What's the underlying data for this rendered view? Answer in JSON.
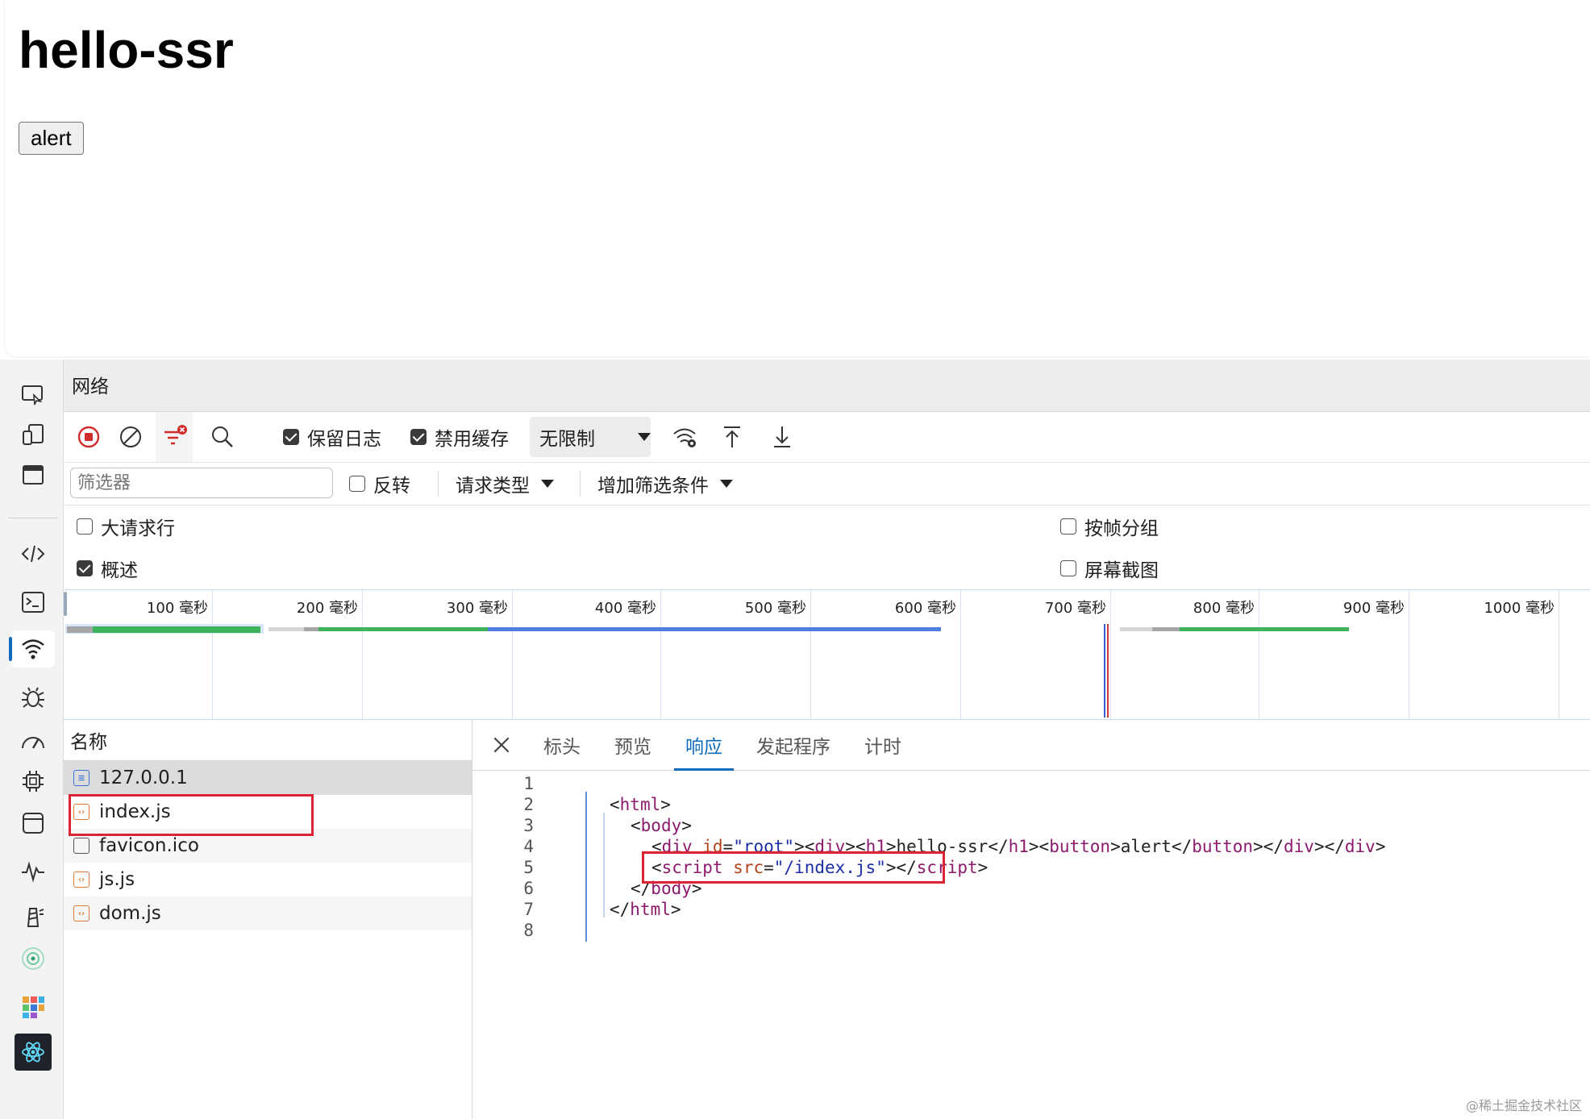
{
  "page": {
    "heading": "hello-ssr",
    "button_label": "alert"
  },
  "panel": {
    "title": "网络"
  },
  "toolbar": {
    "preserve_log": "保留日志",
    "preserve_log_checked": true,
    "disable_cache": "禁用缓存",
    "disable_cache_checked": true,
    "throttling": "无限制"
  },
  "filter": {
    "placeholder": "筛选器",
    "invert": "反转",
    "request_types": "请求类型",
    "more_filters": "增加筛选条件"
  },
  "options": {
    "big_request_rows": "大请求行",
    "overview": "概述",
    "group_by_frame": "按帧分组",
    "screenshots": "屏幕截图"
  },
  "overview": {
    "ticks": [
      "100 毫秒",
      "200 毫秒",
      "300 毫秒",
      "400 毫秒",
      "500 毫秒",
      "600 毫秒",
      "700 毫秒",
      "800 毫秒",
      "900 毫秒",
      "1000 毫秒"
    ]
  },
  "requests": {
    "column_name": "名称",
    "items": [
      {
        "name": "127.0.0.1",
        "icon": "document-icon"
      },
      {
        "name": "index.js",
        "icon": "script-icon"
      },
      {
        "name": "favicon.ico",
        "icon": "file-icon"
      },
      {
        "name": "js.js",
        "icon": "script-icon"
      },
      {
        "name": "dom.js",
        "icon": "script-icon"
      }
    ]
  },
  "detail": {
    "tabs": [
      "标头",
      "预览",
      "响应",
      "发起程序",
      "计时"
    ],
    "active_tab": "响应",
    "line_numbers": [
      "1",
      "2",
      "3",
      "4",
      "5",
      "6",
      "7",
      "8"
    ]
  },
  "watermark": "@稀土掘金技术社区"
}
